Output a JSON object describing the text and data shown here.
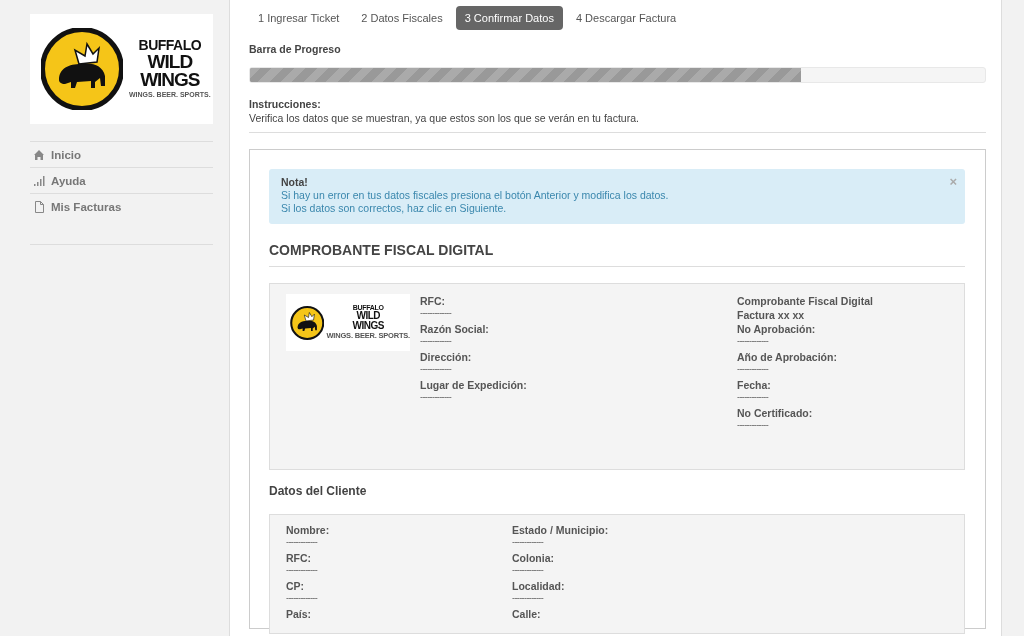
{
  "sidebar": {
    "logo": {
      "line_1": "BUFFALO",
      "line_2": "WILD",
      "line_3": "WINGS",
      "tagline": "WINGS. BEER. SPORTS."
    },
    "nav": [
      {
        "label": "Inicio"
      },
      {
        "label": "Ayuda"
      },
      {
        "label": "Mis Facturas"
      }
    ]
  },
  "steps": [
    {
      "label": "1 Ingresar Ticket",
      "selected": false
    },
    {
      "label": "2 Datos Fiscales",
      "selected": false
    },
    {
      "label": "3 Confirmar Datos",
      "selected": true
    },
    {
      "label": "4 Descargar Factura",
      "selected": false
    }
  ],
  "progress": {
    "label": "Barra de Progreso",
    "level": 0.75
  },
  "instructions": {
    "title": "Instrucciones:",
    "text": "Verifica los datos que se muestran, ya que estos son los que se verán en tu factura."
  },
  "alert": {
    "title": "Nota!",
    "lines": [
      "Si hay un error en tus datos fiscales presiona el botón Anterior y modifica los datos.",
      "Si los datos son correctos, haz clic en Siguiente."
    ],
    "close": "×"
  },
  "invoice": {
    "heading": "COMPROBANTE FISCAL DIGITAL",
    "logo": {
      "line_1": "BUFFALO",
      "line_2": "WILD",
      "line_3": "WINGS",
      "tagline": "WINGS. BEER. SPORTS."
    },
    "issuer_fields": [
      {
        "label": "RFC:",
        "value": "-------------"
      },
      {
        "label": "Razón Social:",
        "value": "-------------"
      },
      {
        "label": "Dirección:",
        "value": "-------------"
      },
      {
        "label": "Lugar de Expedición:",
        "value": "-------------"
      }
    ],
    "document_lines": [
      {
        "kind": "text",
        "label": "Comprobante Fiscal Digital"
      },
      {
        "kind": "text",
        "label": "Factura xx xx"
      },
      {
        "kind": "field",
        "label": "No Aprobación:",
        "value": "-------------"
      },
      {
        "kind": "field",
        "label": "Año de Aprobación:",
        "value": "-------------"
      },
      {
        "kind": "field",
        "label": "Fecha:",
        "value": "-------------"
      },
      {
        "kind": "field",
        "label": "No Certificado:",
        "value": "-------------"
      }
    ]
  },
  "client": {
    "heading": "Datos del Cliente",
    "columns": [
      [
        {
          "label": "Nombre:",
          "value": "-------------"
        },
        {
          "label": "RFC:",
          "value": "-------------"
        },
        {
          "label": "CP:",
          "value": "-------------"
        },
        {
          "label": "País:"
        }
      ],
      [
        {
          "label": "Estado / Municipio:",
          "value": "-------------"
        },
        {
          "label": "Colonia:",
          "value": "-------------"
        },
        {
          "label": "Localidad:",
          "value": "-------------"
        },
        {
          "label": "Calle:"
        }
      ]
    ]
  }
}
